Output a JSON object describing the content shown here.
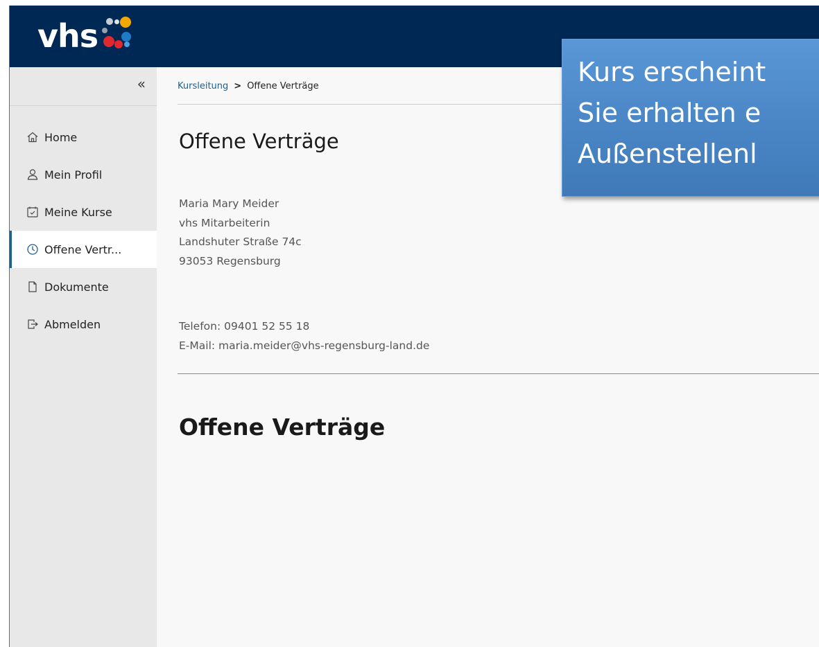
{
  "header": {
    "logo_text": "vhs"
  },
  "sidebar": {
    "collapse_label": "«",
    "items": [
      {
        "label": "Home",
        "icon": "home-icon"
      },
      {
        "label": "Mein Profil",
        "icon": "user-icon"
      },
      {
        "label": "Meine Kurse",
        "icon": "calendar-check-icon"
      },
      {
        "label": "Offene Vertr...",
        "icon": "clock-icon",
        "active": true
      },
      {
        "label": "Dokumente",
        "icon": "document-icon"
      },
      {
        "label": "Abmelden",
        "icon": "logout-icon"
      }
    ]
  },
  "breadcrumb": {
    "parent": "Kursleitung",
    "separator": ">",
    "current": "Offene Verträge"
  },
  "main": {
    "title": "Offene Verträge",
    "address": {
      "name": "Maria Mary Meider",
      "role": "vhs Mitarbeiterin",
      "street": "Landshuter Straße 74c",
      "city": "93053 Regensburg"
    },
    "contact": {
      "phone": "Telefon: 09401 52 55 18",
      "email": "E-Mail: maria.meider@vhs-regensburg-land.de"
    },
    "section_title": "Offene Verträge"
  },
  "callout": {
    "line1": "Kurs erscheint",
    "line2": "Sie erhalten e",
    "line3": "Außenstellenl"
  },
  "colors": {
    "header_bg": "#002855",
    "sidebar_bg": "#e8e8e8",
    "active_indicator": "#1f5f8b",
    "link": "#1a5f95",
    "callout_bg": "#4a86c6"
  }
}
